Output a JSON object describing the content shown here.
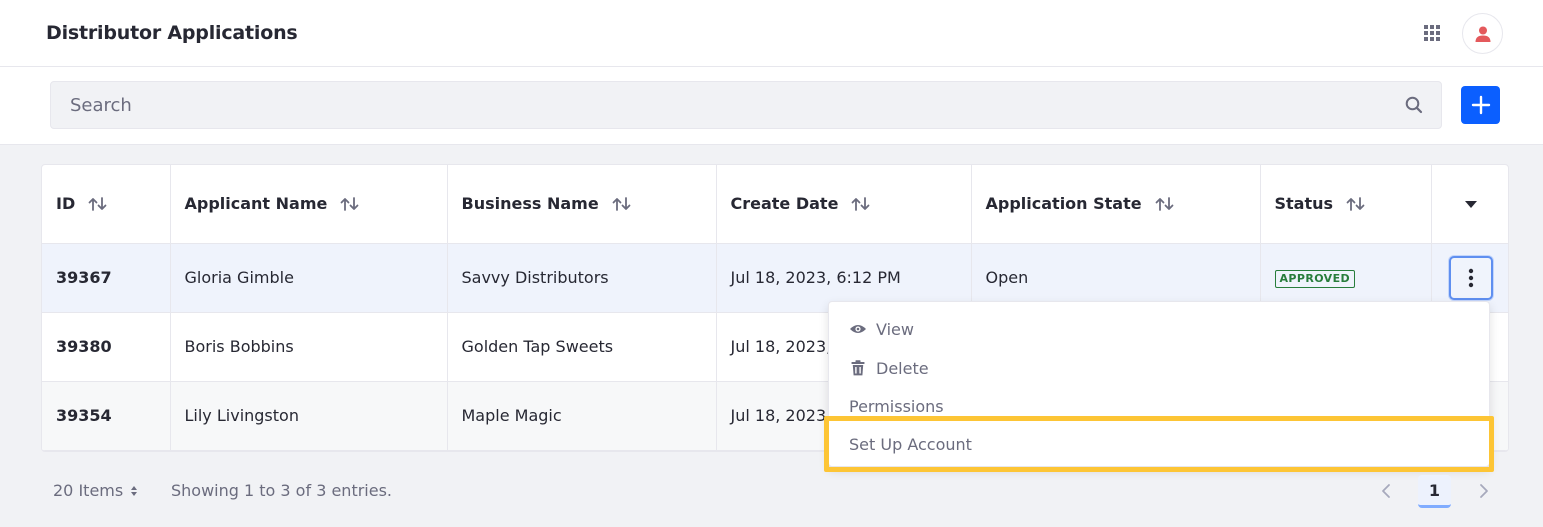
{
  "header": {
    "title": "Distributor Applications"
  },
  "search": {
    "placeholder": "Search"
  },
  "table": {
    "columns": [
      "ID",
      "Applicant Name",
      "Business Name",
      "Create Date",
      "Application State",
      "Status"
    ],
    "rows": [
      {
        "id": "39367",
        "applicant": "Gloria Gimble",
        "business": "Savvy Distributors",
        "date": "Jul 18, 2023, 6:12 PM",
        "state": "Open",
        "status": "APPROVED"
      },
      {
        "id": "39380",
        "applicant": "Boris Bobbins",
        "business": "Golden Tap Sweets",
        "date": "Jul 18, 2023,",
        "state": "",
        "status": ""
      },
      {
        "id": "39354",
        "applicant": "Lily Livingston",
        "business": "Maple Magic",
        "date": "Jul 18, 2023,",
        "state": "",
        "status": ""
      }
    ]
  },
  "menu": {
    "view": "View",
    "delete": "Delete",
    "permissions": "Permissions",
    "setup_account": "Set Up Account"
  },
  "footer": {
    "items_per_page": "20 Items",
    "showing": "Showing 1 to 3 of 3 entries.",
    "current_page": "1"
  },
  "colors": {
    "primary": "#0b5fff",
    "approved": "#287d3c",
    "highlight": "#fdc535",
    "avatar_icon": "#e4595c"
  },
  "icons": {
    "apps": "apps-grid-icon",
    "user": "user-icon",
    "search": "search-icon",
    "add": "plus-icon",
    "sort": "sort-arrows-icon",
    "column_menu": "caret-down-icon",
    "actions": "kebab-icon",
    "view": "eye-icon",
    "delete": "trash-icon",
    "pager_prev": "chevron-left-icon",
    "pager_next": "chevron-right-icon"
  }
}
